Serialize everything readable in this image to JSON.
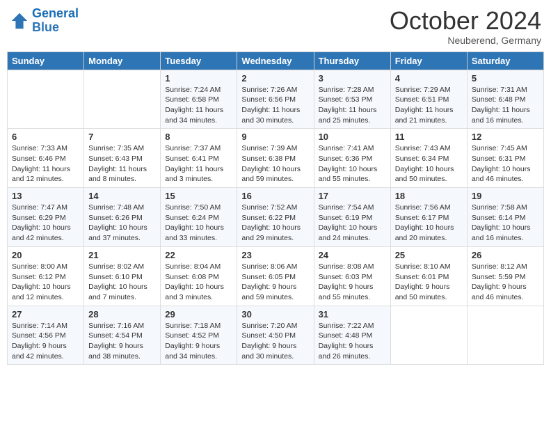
{
  "header": {
    "logo_line1": "General",
    "logo_line2": "Blue",
    "month": "October 2024",
    "location": "Neuberend, Germany"
  },
  "days_of_week": [
    "Sunday",
    "Monday",
    "Tuesday",
    "Wednesday",
    "Thursday",
    "Friday",
    "Saturday"
  ],
  "weeks": [
    [
      {
        "day": "",
        "sunrise": "",
        "sunset": "",
        "daylight": ""
      },
      {
        "day": "",
        "sunrise": "",
        "sunset": "",
        "daylight": ""
      },
      {
        "day": "1",
        "sunrise": "Sunrise: 7:24 AM",
        "sunset": "Sunset: 6:58 PM",
        "daylight": "Daylight: 11 hours and 34 minutes."
      },
      {
        "day": "2",
        "sunrise": "Sunrise: 7:26 AM",
        "sunset": "Sunset: 6:56 PM",
        "daylight": "Daylight: 11 hours and 30 minutes."
      },
      {
        "day": "3",
        "sunrise": "Sunrise: 7:28 AM",
        "sunset": "Sunset: 6:53 PM",
        "daylight": "Daylight: 11 hours and 25 minutes."
      },
      {
        "day": "4",
        "sunrise": "Sunrise: 7:29 AM",
        "sunset": "Sunset: 6:51 PM",
        "daylight": "Daylight: 11 hours and 21 minutes."
      },
      {
        "day": "5",
        "sunrise": "Sunrise: 7:31 AM",
        "sunset": "Sunset: 6:48 PM",
        "daylight": "Daylight: 11 hours and 16 minutes."
      }
    ],
    [
      {
        "day": "6",
        "sunrise": "Sunrise: 7:33 AM",
        "sunset": "Sunset: 6:46 PM",
        "daylight": "Daylight: 11 hours and 12 minutes."
      },
      {
        "day": "7",
        "sunrise": "Sunrise: 7:35 AM",
        "sunset": "Sunset: 6:43 PM",
        "daylight": "Daylight: 11 hours and 8 minutes."
      },
      {
        "day": "8",
        "sunrise": "Sunrise: 7:37 AM",
        "sunset": "Sunset: 6:41 PM",
        "daylight": "Daylight: 11 hours and 3 minutes."
      },
      {
        "day": "9",
        "sunrise": "Sunrise: 7:39 AM",
        "sunset": "Sunset: 6:38 PM",
        "daylight": "Daylight: 10 hours and 59 minutes."
      },
      {
        "day": "10",
        "sunrise": "Sunrise: 7:41 AM",
        "sunset": "Sunset: 6:36 PM",
        "daylight": "Daylight: 10 hours and 55 minutes."
      },
      {
        "day": "11",
        "sunrise": "Sunrise: 7:43 AM",
        "sunset": "Sunset: 6:34 PM",
        "daylight": "Daylight: 10 hours and 50 minutes."
      },
      {
        "day": "12",
        "sunrise": "Sunrise: 7:45 AM",
        "sunset": "Sunset: 6:31 PM",
        "daylight": "Daylight: 10 hours and 46 minutes."
      }
    ],
    [
      {
        "day": "13",
        "sunrise": "Sunrise: 7:47 AM",
        "sunset": "Sunset: 6:29 PM",
        "daylight": "Daylight: 10 hours and 42 minutes."
      },
      {
        "day": "14",
        "sunrise": "Sunrise: 7:48 AM",
        "sunset": "Sunset: 6:26 PM",
        "daylight": "Daylight: 10 hours and 37 minutes."
      },
      {
        "day": "15",
        "sunrise": "Sunrise: 7:50 AM",
        "sunset": "Sunset: 6:24 PM",
        "daylight": "Daylight: 10 hours and 33 minutes."
      },
      {
        "day": "16",
        "sunrise": "Sunrise: 7:52 AM",
        "sunset": "Sunset: 6:22 PM",
        "daylight": "Daylight: 10 hours and 29 minutes."
      },
      {
        "day": "17",
        "sunrise": "Sunrise: 7:54 AM",
        "sunset": "Sunset: 6:19 PM",
        "daylight": "Daylight: 10 hours and 24 minutes."
      },
      {
        "day": "18",
        "sunrise": "Sunrise: 7:56 AM",
        "sunset": "Sunset: 6:17 PM",
        "daylight": "Daylight: 10 hours and 20 minutes."
      },
      {
        "day": "19",
        "sunrise": "Sunrise: 7:58 AM",
        "sunset": "Sunset: 6:14 PM",
        "daylight": "Daylight: 10 hours and 16 minutes."
      }
    ],
    [
      {
        "day": "20",
        "sunrise": "Sunrise: 8:00 AM",
        "sunset": "Sunset: 6:12 PM",
        "daylight": "Daylight: 10 hours and 12 minutes."
      },
      {
        "day": "21",
        "sunrise": "Sunrise: 8:02 AM",
        "sunset": "Sunset: 6:10 PM",
        "daylight": "Daylight: 10 hours and 7 minutes."
      },
      {
        "day": "22",
        "sunrise": "Sunrise: 8:04 AM",
        "sunset": "Sunset: 6:08 PM",
        "daylight": "Daylight: 10 hours and 3 minutes."
      },
      {
        "day": "23",
        "sunrise": "Sunrise: 8:06 AM",
        "sunset": "Sunset: 6:05 PM",
        "daylight": "Daylight: 9 hours and 59 minutes."
      },
      {
        "day": "24",
        "sunrise": "Sunrise: 8:08 AM",
        "sunset": "Sunset: 6:03 PM",
        "daylight": "Daylight: 9 hours and 55 minutes."
      },
      {
        "day": "25",
        "sunrise": "Sunrise: 8:10 AM",
        "sunset": "Sunset: 6:01 PM",
        "daylight": "Daylight: 9 hours and 50 minutes."
      },
      {
        "day": "26",
        "sunrise": "Sunrise: 8:12 AM",
        "sunset": "Sunset: 5:59 PM",
        "daylight": "Daylight: 9 hours and 46 minutes."
      }
    ],
    [
      {
        "day": "27",
        "sunrise": "Sunrise: 7:14 AM",
        "sunset": "Sunset: 4:56 PM",
        "daylight": "Daylight: 9 hours and 42 minutes."
      },
      {
        "day": "28",
        "sunrise": "Sunrise: 7:16 AM",
        "sunset": "Sunset: 4:54 PM",
        "daylight": "Daylight: 9 hours and 38 minutes."
      },
      {
        "day": "29",
        "sunrise": "Sunrise: 7:18 AM",
        "sunset": "Sunset: 4:52 PM",
        "daylight": "Daylight: 9 hours and 34 minutes."
      },
      {
        "day": "30",
        "sunrise": "Sunrise: 7:20 AM",
        "sunset": "Sunset: 4:50 PM",
        "daylight": "Daylight: 9 hours and 30 minutes."
      },
      {
        "day": "31",
        "sunrise": "Sunrise: 7:22 AM",
        "sunset": "Sunset: 4:48 PM",
        "daylight": "Daylight: 9 hours and 26 minutes."
      },
      {
        "day": "",
        "sunrise": "",
        "sunset": "",
        "daylight": ""
      },
      {
        "day": "",
        "sunrise": "",
        "sunset": "",
        "daylight": ""
      }
    ]
  ]
}
